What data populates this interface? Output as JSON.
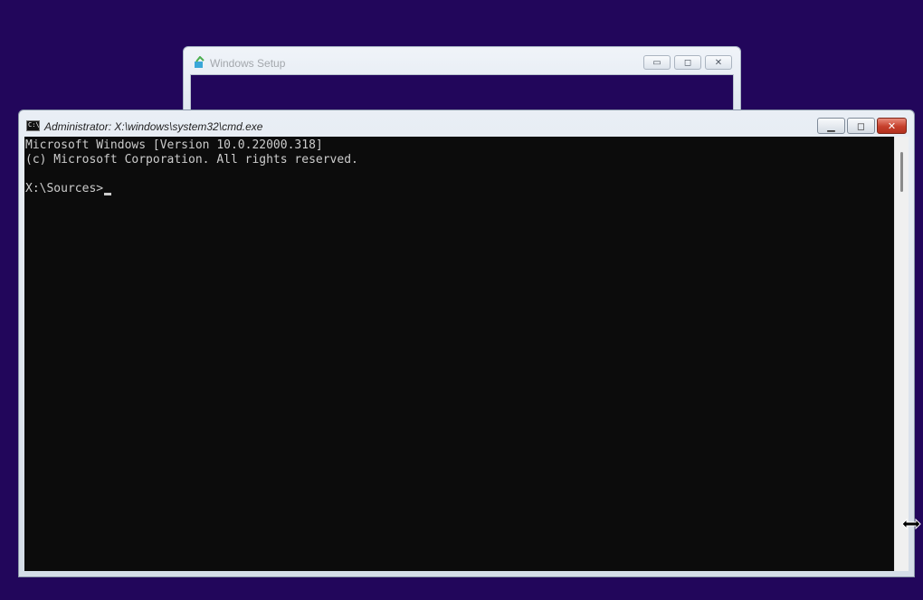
{
  "setup_window": {
    "title": "Windows Setup",
    "buttons": {
      "minimize": "▭",
      "maximize": "◻",
      "close": "✕"
    }
  },
  "cmd_window": {
    "title": "Administrator: X:\\windows\\system32\\cmd.exe",
    "icon_text": "C:\\",
    "buttons": {
      "minimize": "▁",
      "maximize": "◻",
      "close": "✕"
    },
    "console_lines": [
      "Microsoft Windows [Version 10.0.22000.318]",
      "(c) Microsoft Corporation. All rights reserved.",
      "",
      "X:\\Sources>"
    ]
  },
  "colors": {
    "desktop": "#22065b",
    "console_bg": "#0c0c0c",
    "console_fg": "#cccccc",
    "close_button": "#c6402c"
  }
}
